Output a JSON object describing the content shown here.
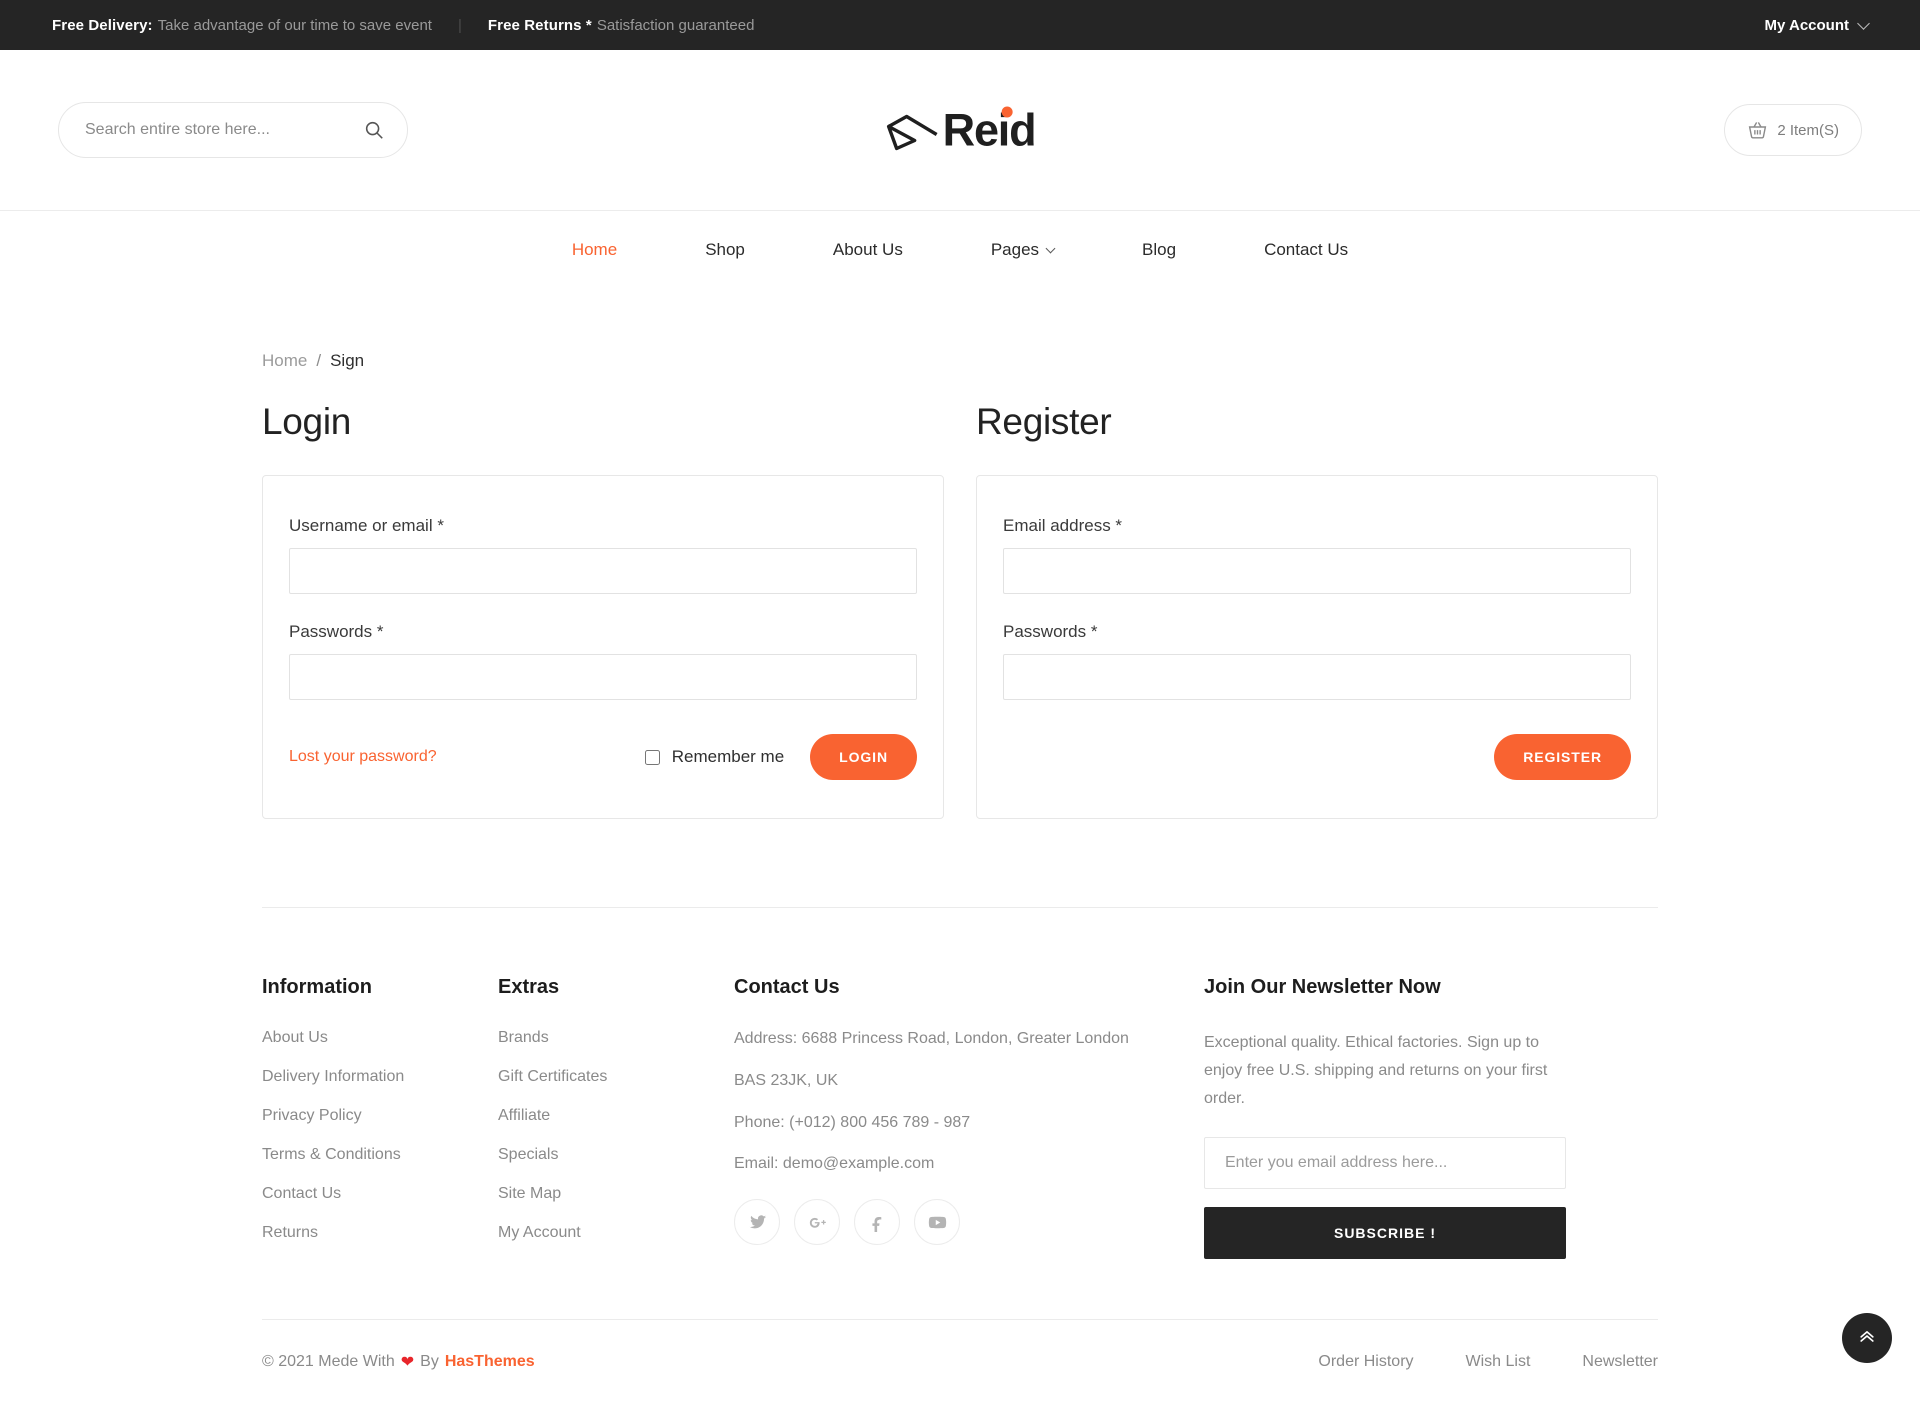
{
  "topbar": {
    "free_delivery_label": "Free Delivery:",
    "free_delivery_text": "Take advantage of our time to save event",
    "separator": "|",
    "free_returns_label": "Free Returns *",
    "free_returns_text": "Satisfaction guaranteed",
    "my_account": "My Account"
  },
  "header": {
    "search_placeholder": "Search entire store here...",
    "search_value": "",
    "search_icon": "search-icon",
    "logo_text": "Reid",
    "logo_mark_icon": "reid-arrow-logo-icon",
    "cart_icon": "basket-icon",
    "cart_label": "2 Item(S)"
  },
  "nav": {
    "items": [
      {
        "label": "Home",
        "active": true,
        "has_caret": false
      },
      {
        "label": "Shop",
        "active": false,
        "has_caret": false
      },
      {
        "label": "About Us",
        "active": false,
        "has_caret": false
      },
      {
        "label": "Pages",
        "active": false,
        "has_caret": true
      },
      {
        "label": "Blog",
        "active": false,
        "has_caret": false
      },
      {
        "label": "Contact Us",
        "active": false,
        "has_caret": false
      }
    ]
  },
  "breadcrumb": {
    "home": "Home",
    "separator": "/",
    "current": "Sign"
  },
  "login": {
    "title": "Login",
    "username_label": "Username or email *",
    "username_value": "",
    "password_label": "Passwords *",
    "password_value": "",
    "lost_password": "Lost your password?",
    "remember_label": "Remember me",
    "remember_checked": false,
    "submit_label": "LOGIN"
  },
  "register": {
    "title": "Register",
    "email_label": "Email address *",
    "email_value": "",
    "password_label": "Passwords *",
    "password_value": "",
    "submit_label": "REGISTER"
  },
  "footer": {
    "information": {
      "title": "Information",
      "links": [
        "About Us",
        "Delivery Information",
        "Privacy Policy",
        "Terms & Conditions",
        "Contact Us",
        "Returns"
      ]
    },
    "extras": {
      "title": "Extras",
      "links": [
        "Brands",
        "Gift Certificates",
        "Affiliate",
        "Specials",
        "Site Map",
        "My Account"
      ]
    },
    "contact": {
      "title": "Contact Us",
      "address_line1": "Address: 6688 Princess Road, London, Greater London",
      "address_line2": "BAS 23JK, UK",
      "phone": "Phone: (+012) 800 456 789 - 987",
      "email": "Email: demo@example.com",
      "socials": [
        "twitter-icon",
        "google-plus-icon",
        "facebook-icon",
        "youtube-icon"
      ]
    },
    "newsletter": {
      "title": "Join Our Newsletter Now",
      "text": "Exceptional quality. Ethical factories. Sign up to enjoy free U.S. shipping and returns on your first order.",
      "placeholder": "Enter you email address here...",
      "value": "",
      "button": "SUBSCRIBE !"
    },
    "bottom": {
      "copyright_prefix": "© 2021 Mede With",
      "heart": "❤",
      "copyright_mid": "By",
      "brand": "HasThemes",
      "links": [
        "Order History",
        "Wish List",
        "Newsletter"
      ]
    },
    "scroll_top_icon": "chevron-up-icon"
  },
  "colors": {
    "accent": "#f96331",
    "dark": "#252525",
    "muted": "#8a8a8a",
    "heart": "#e8262b"
  }
}
